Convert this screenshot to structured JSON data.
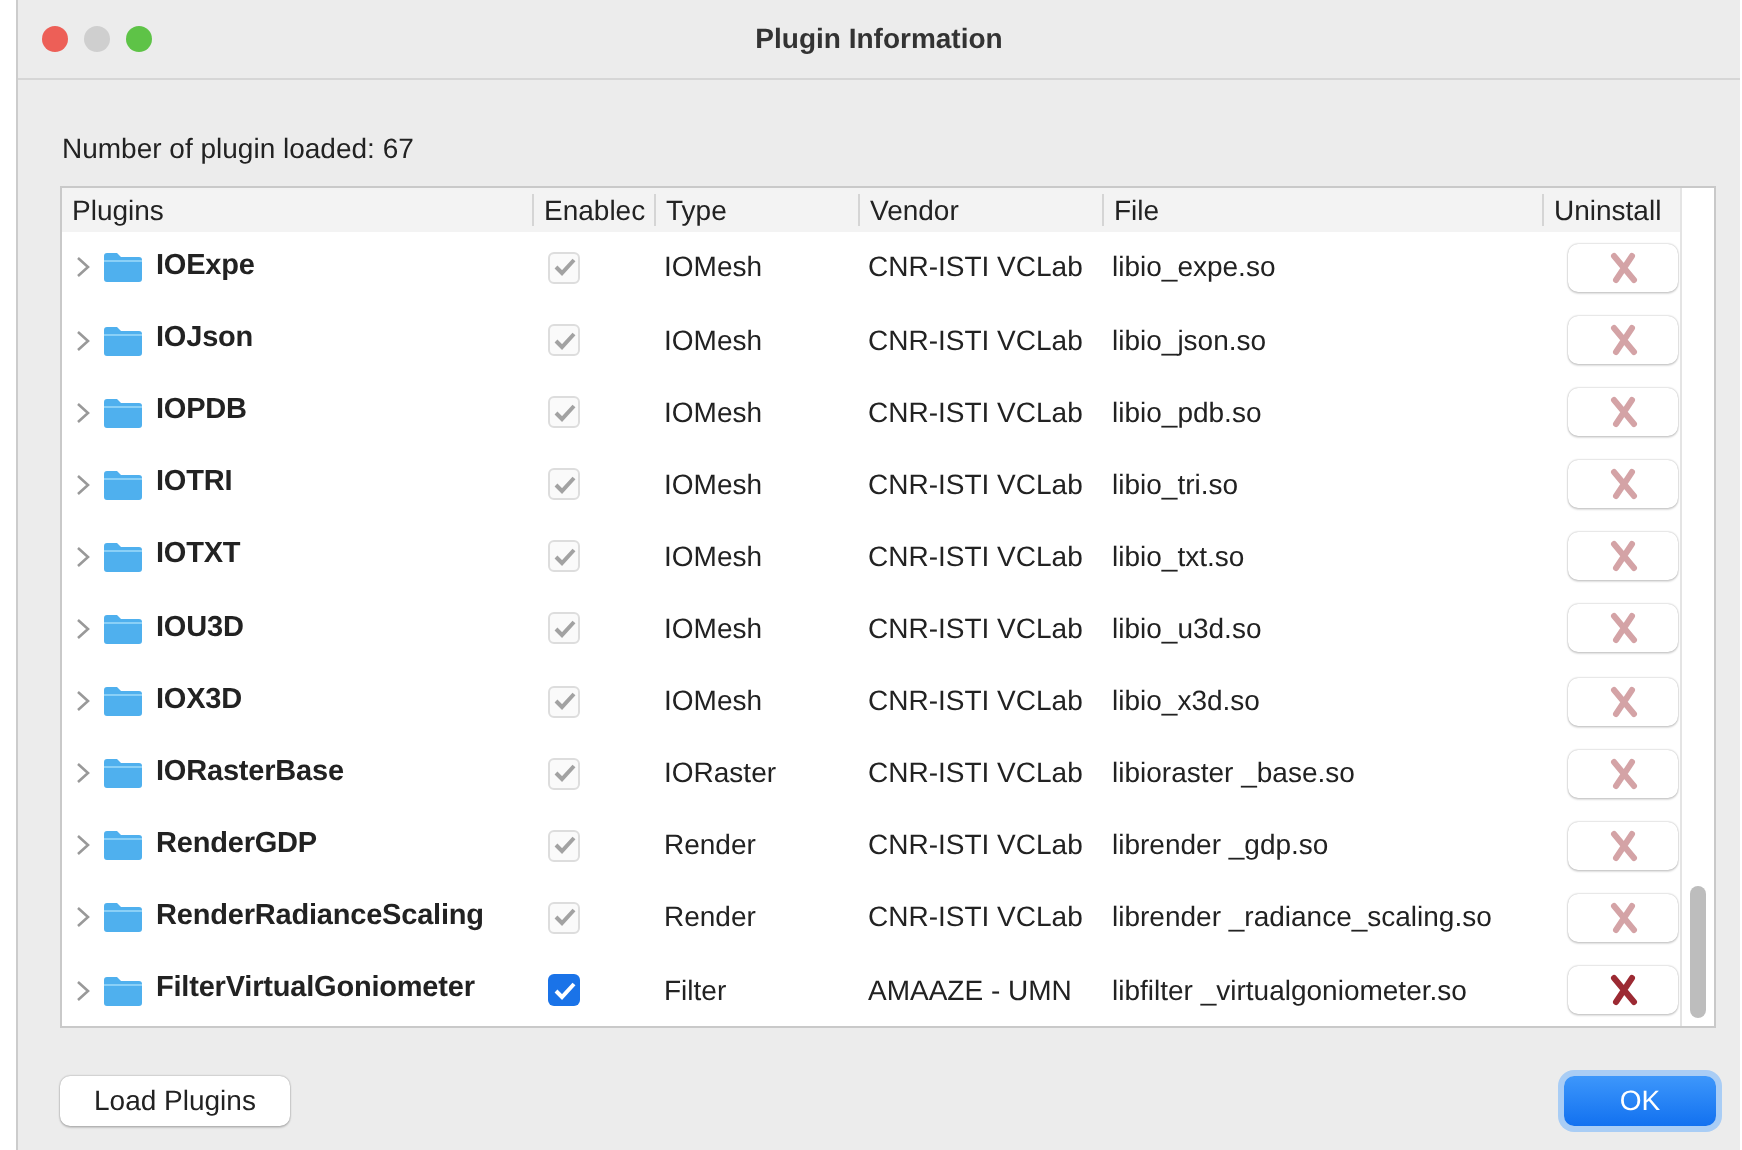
{
  "window": {
    "title": "Plugin Information"
  },
  "summary": "Number of plugin loaded: 67",
  "table": {
    "columns": [
      "Plugins",
      "Enablec",
      "Type",
      "Vendor",
      "File",
      "Uninstall"
    ],
    "rows": [
      {
        "name": "IOExpe",
        "enabled": {
          "checked": true,
          "disabled": true
        },
        "type": "IOMesh",
        "vendor": "CNR-ISTI VCLab",
        "file": "libio_expe.so",
        "uninstall_disabled": true
      },
      {
        "name": "IOJson",
        "enabled": {
          "checked": true,
          "disabled": true
        },
        "type": "IOMesh",
        "vendor": "CNR-ISTI VCLab",
        "file": "libio_json.so",
        "uninstall_disabled": true
      },
      {
        "name": "IOPDB",
        "enabled": {
          "checked": true,
          "disabled": true
        },
        "type": "IOMesh",
        "vendor": "CNR-ISTI VCLab",
        "file": "libio_pdb.so",
        "uninstall_disabled": true
      },
      {
        "name": "IOTRI",
        "enabled": {
          "checked": true,
          "disabled": true
        },
        "type": "IOMesh",
        "vendor": "CNR-ISTI VCLab",
        "file": "libio_tri.so",
        "uninstall_disabled": true
      },
      {
        "name": "IOTXT",
        "enabled": {
          "checked": true,
          "disabled": true
        },
        "type": "IOMesh",
        "vendor": "CNR-ISTI VCLab",
        "file": "libio_txt.so",
        "uninstall_disabled": true
      },
      {
        "name": "IOU3D",
        "enabled": {
          "checked": true,
          "disabled": true
        },
        "type": "IOMesh",
        "vendor": "CNR-ISTI VCLab",
        "file": "libio_u3d.so",
        "uninstall_disabled": true
      },
      {
        "name": "IOX3D",
        "enabled": {
          "checked": true,
          "disabled": true
        },
        "type": "IOMesh",
        "vendor": "CNR-ISTI VCLab",
        "file": "libio_x3d.so",
        "uninstall_disabled": true
      },
      {
        "name": "IORasterBase",
        "enabled": {
          "checked": true,
          "disabled": true
        },
        "type": "IORaster",
        "vendor": "CNR-ISTI VCLab",
        "file": "libioraster _base.so",
        "uninstall_disabled": true
      },
      {
        "name": "RenderGDP",
        "enabled": {
          "checked": true,
          "disabled": true
        },
        "type": "Render",
        "vendor": "CNR-ISTI VCLab",
        "file": "librender _gdp.so",
        "uninstall_disabled": true
      },
      {
        "name": "RenderRadianceScaling",
        "enabled": {
          "checked": true,
          "disabled": true
        },
        "type": "Render",
        "vendor": "CNR-ISTI VCLab",
        "file": "librender _radiance_scaling.so",
        "uninstall_disabled": true
      },
      {
        "name": "FilterVirtualGoniometer",
        "enabled": {
          "checked": true,
          "disabled": false
        },
        "type": "Filter",
        "vendor": "AMAAZE - UMN",
        "file": "libfilter _virtualgoniometer.so",
        "uninstall_disabled": false
      }
    ]
  },
  "buttons": {
    "load": "Load Plugins",
    "ok": "OK"
  }
}
